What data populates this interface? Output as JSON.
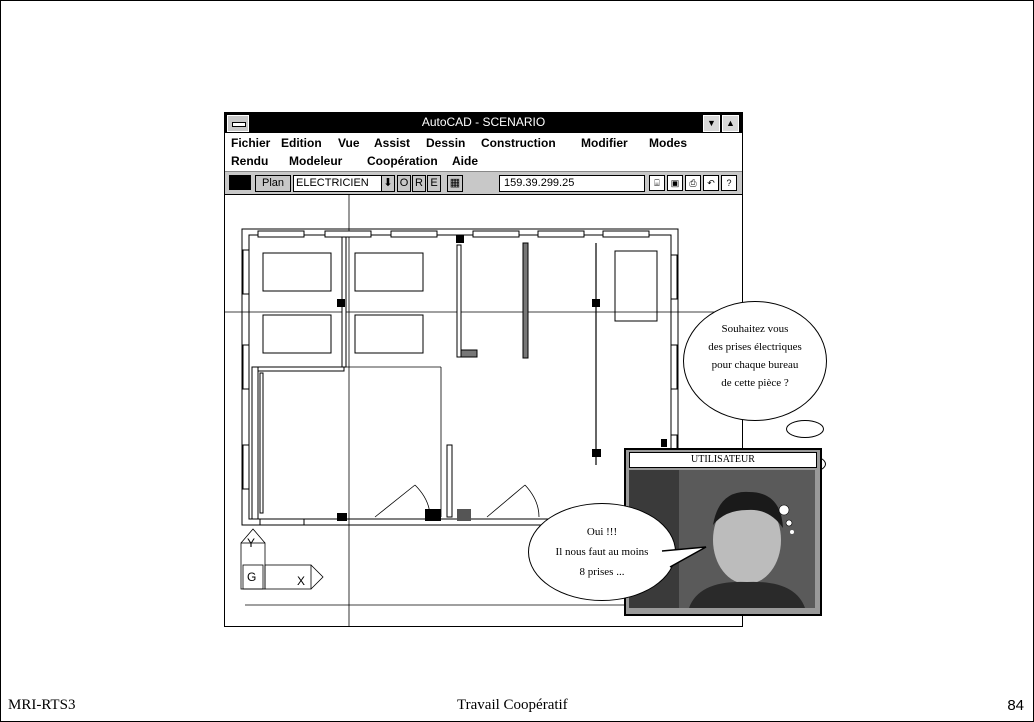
{
  "window": {
    "title": "AutoCAD - SCENARIO",
    "menu_row1": [
      "Fichier",
      "Edition",
      "Vue",
      "Assist",
      "Dessin",
      "Construction",
      "Modifier",
      "Modes"
    ],
    "menu_row2": [
      "Rendu",
      "Modeleur",
      "Coopération",
      "Aide"
    ],
    "toolbar": {
      "plan_label": "Plan",
      "layer_value": "ELECTRICIEN",
      "toggle_o": "O",
      "toggle_r": "R",
      "toggle_e": "E",
      "coords": "159.39.299.25"
    },
    "ucs": {
      "y_label": "Y",
      "g_label": "G",
      "x_label": "X"
    }
  },
  "bubbles": {
    "question": [
      "Souhaitez vous",
      "des prises électriques",
      "pour chaque bureau",
      "de cette pièce ?"
    ],
    "answer": [
      "Oui !!!",
      "Il nous faut au moins",
      "8 prises ..."
    ]
  },
  "user_panel": {
    "label": "UTILISATEUR"
  },
  "footer": {
    "left": "MRI-RTS3",
    "center": "Travail Coopératif",
    "page": "84"
  }
}
